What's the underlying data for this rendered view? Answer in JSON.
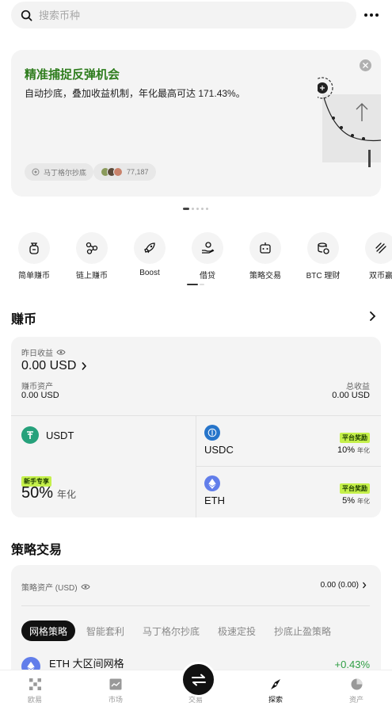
{
  "search": {
    "placeholder": "搜索币种"
  },
  "banner": {
    "title": "精准捕捉反弹机会",
    "subtitle": "自动抄底，叠加收益机制，年化最高可达 171.43%。",
    "chip_bot": "马丁格尔抄底",
    "chip_users": "77,187",
    "page_count": 5,
    "active_page": 0
  },
  "quick": [
    {
      "label": "简单赚币",
      "icon": "money-bag-icon"
    },
    {
      "label": "链上赚币",
      "icon": "chain-nodes-icon"
    },
    {
      "label": "Boost",
      "icon": "rocket-icon"
    },
    {
      "label": "借贷",
      "icon": "loan-hand-icon"
    },
    {
      "label": "策略交易",
      "icon": "robot-icon"
    },
    {
      "label": "BTC 理财",
      "icon": "btc-stack-icon"
    },
    {
      "label": "双币赢",
      "icon": "dual-coin-icon"
    }
  ],
  "earn": {
    "title": "赚币",
    "yesterday_label": "昨日收益",
    "yesterday_value": "0.00 USD",
    "assets_label": "赚币资产",
    "assets_value": "0.00 USD",
    "total_label": "总收益",
    "total_value": "0.00 USD",
    "usdt": {
      "name": "USDT",
      "badge": "新手专享",
      "apy": "50%",
      "apy_unit": "年化"
    },
    "usdc": {
      "name": "USDC",
      "badge": "平台奖励",
      "apy": "10%",
      "apy_unit": "年化"
    },
    "eth": {
      "name": "ETH",
      "badge": "平台奖励",
      "apy": "5%",
      "apy_unit": "年化"
    },
    "colors": {
      "usdt": "#26a17b",
      "usdc": "#2775ca",
      "eth": "#627eea",
      "badge": "#c5f04b"
    }
  },
  "strategy": {
    "title": "策略交易",
    "assets_label": "策略资产 (USD)",
    "assets_value": "0.00 (0.00)",
    "tabs": [
      "网格策略",
      "智能套利",
      "马丁格尔抄底",
      "极速定投",
      "抄底止盈策略"
    ],
    "first_item": {
      "name": "ETH 大区间网格",
      "change": "+0.43%"
    },
    "colors": {
      "positive": "#2f9e44"
    }
  },
  "nav": [
    {
      "label": "欧易",
      "icon": "okx-logo-icon"
    },
    {
      "label": "市场",
      "icon": "chart-icon"
    },
    {
      "label": "交易",
      "icon": "swap-arrows-icon"
    },
    {
      "label": "探索",
      "icon": "compass-icon",
      "active": true
    },
    {
      "label": "资产",
      "icon": "pie-chart-icon"
    }
  ]
}
